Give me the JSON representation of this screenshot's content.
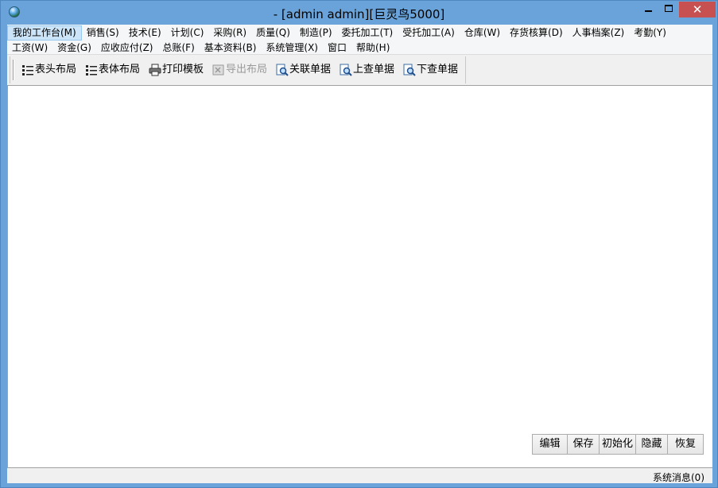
{
  "window": {
    "title": "-  [admin admin][巨灵鸟5000]",
    "close_glyph": "✕"
  },
  "menubar": {
    "row1": [
      {
        "label": "我的工作台(M)",
        "active": true
      },
      {
        "label": "销售(S)"
      },
      {
        "label": "技术(E)"
      },
      {
        "label": "计划(C)"
      },
      {
        "label": "采购(R)"
      },
      {
        "label": "质量(Q)"
      },
      {
        "label": "制造(P)"
      },
      {
        "label": "委托加工(T)"
      },
      {
        "label": "受托加工(A)"
      },
      {
        "label": "仓库(W)"
      },
      {
        "label": "存货核算(D)"
      },
      {
        "label": "人事档案(Z)"
      },
      {
        "label": "考勤(Y)"
      }
    ],
    "row2": [
      {
        "label": "工资(W)"
      },
      {
        "label": "资金(G)"
      },
      {
        "label": "应收应付(Z)"
      },
      {
        "label": "总账(F)"
      },
      {
        "label": "基本资料(B)"
      },
      {
        "label": "系统管理(X)"
      },
      {
        "label": "窗口"
      },
      {
        "label": "帮助(H)"
      }
    ]
  },
  "toolbar": {
    "header_layout": "表头布局",
    "body_layout": "表体布局",
    "print_template": "打印模板",
    "export_layout": "导出布局",
    "related_docs": "关联单据",
    "prev_doc": "上查单据",
    "next_doc": "下查单据"
  },
  "actions": {
    "edit": "编辑",
    "save": "保存",
    "init": "初始化",
    "hide": "隐藏",
    "restore": "恢复"
  },
  "status": {
    "messages": "系统消息(0)"
  },
  "colors": {
    "frame": "#6aa3d9",
    "close_button": "#c75050",
    "menu_highlight": "#cce4f7"
  }
}
